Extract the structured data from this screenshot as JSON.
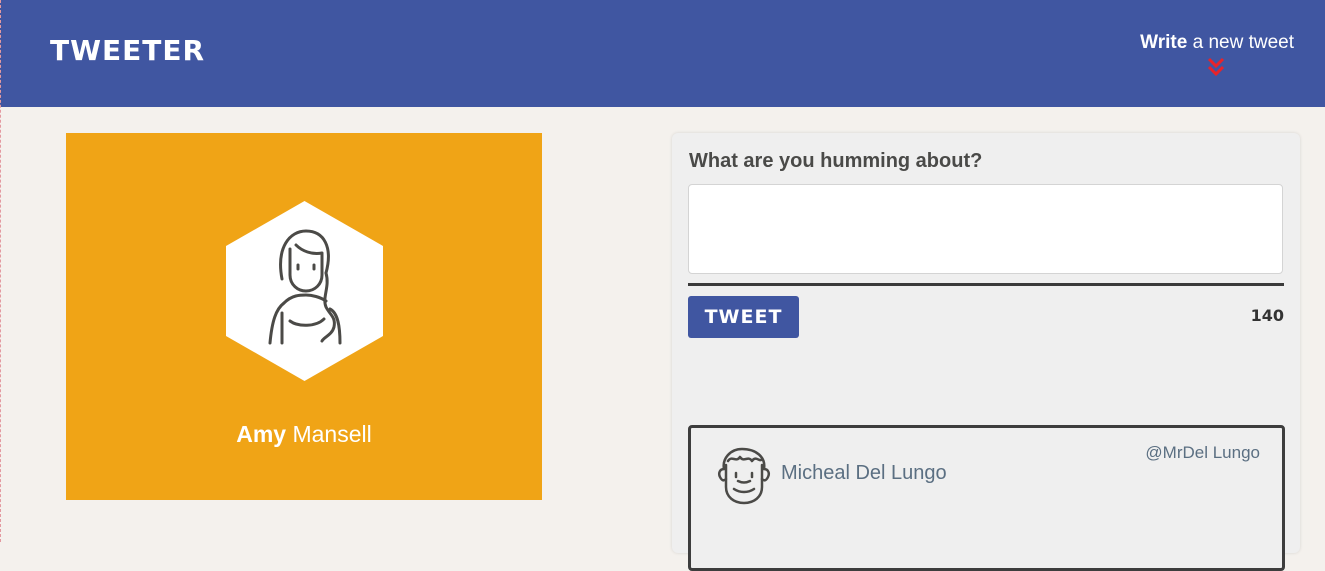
{
  "header": {
    "logo": "TWEETER",
    "write_bold": "Write",
    "write_rest": " a new tweet",
    "chevron_color": "#e8232a",
    "bg_color": "#4056a1"
  },
  "profile": {
    "first_name": "Amy",
    "last_name": " Mansell",
    "avatar_icon": "woman-avatar-icon",
    "bg_color": "#f0a416"
  },
  "compose": {
    "label": "What are you humming about?",
    "input_value": "",
    "button_label": "TWEET",
    "char_count": "140"
  },
  "tweets": [
    {
      "name": "Micheal Del Lungo",
      "handle": "@MrDel Lungo",
      "avatar_icon": "man-avatar-icon"
    }
  ]
}
